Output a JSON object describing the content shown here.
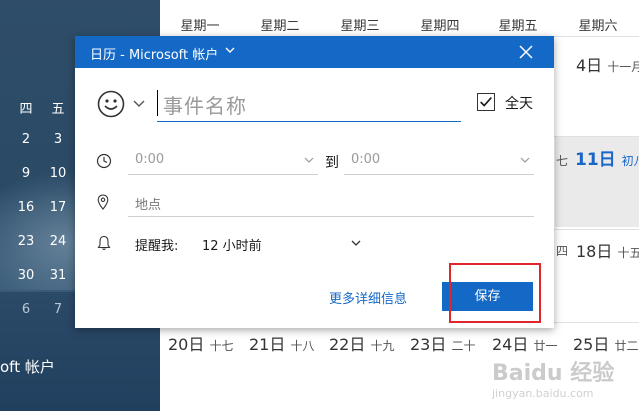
{
  "sidebar": {
    "weekdays": [
      "四",
      "五"
    ],
    "rows": [
      [
        "2",
        "3"
      ],
      [
        "9",
        "10"
      ],
      [
        "16",
        "17"
      ],
      [
        "23",
        "24"
      ],
      [
        "30",
        "31"
      ],
      [
        "6",
        "7"
      ]
    ],
    "account_label": "oft 帐户"
  },
  "week_header": {
    "days": [
      "星期一",
      "星期二",
      "星期三",
      "星期四",
      "星期五",
      "星期六"
    ]
  },
  "calendar": {
    "top_right": {
      "num": "4日",
      "lunar": "十一月"
    },
    "row2_left": {
      "lunar": "七"
    },
    "today": {
      "num": "11日",
      "lunar": "初八"
    },
    "row3_left": {
      "lunar": "四"
    },
    "row3_right": {
      "num": "18日",
      "lunar": "十五"
    },
    "bottom_row": [
      {
        "num": "20日",
        "lunar": "十七"
      },
      {
        "num": "21日",
        "lunar": "十八"
      },
      {
        "num": "22日",
        "lunar": "十九"
      },
      {
        "num": "23日",
        "lunar": "二十"
      },
      {
        "num": "24日",
        "lunar": "廿一"
      },
      {
        "num": "25日",
        "lunar": "廿二"
      }
    ]
  },
  "dialog": {
    "title": "日历 - Microsoft 帐户",
    "event_name_placeholder": "事件名称",
    "all_day_label": "全天",
    "all_day_checked": true,
    "start_time": "0:00",
    "to_label": "到",
    "end_time": "0:00",
    "location_placeholder": "地点",
    "reminder_label": "提醒我:",
    "reminder_value": "12 小时前",
    "more_details": "更多详细信息",
    "save": "保存"
  },
  "watermark": {
    "brand": "Baidu 经验",
    "url": "jingyan.baidu.com"
  },
  "colors": {
    "accent": "#1469c7",
    "highlight": "#e0262b",
    "today": "#1a67c9"
  }
}
